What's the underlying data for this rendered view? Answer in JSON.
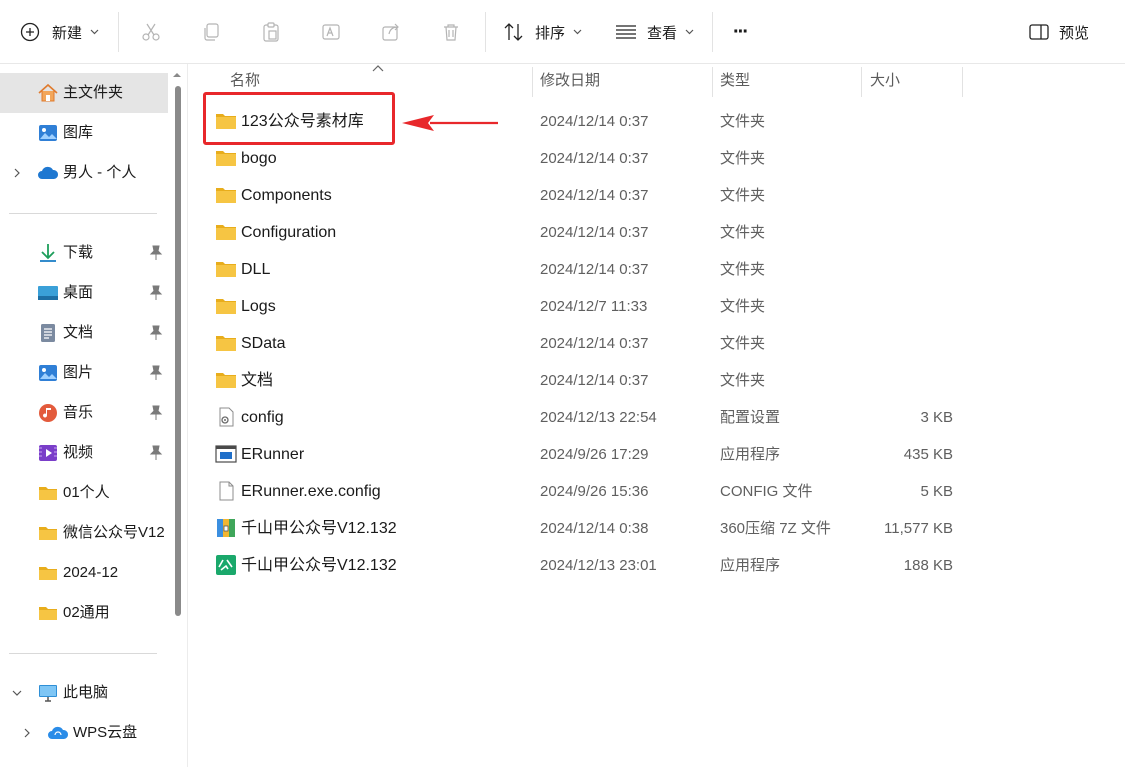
{
  "toolbar": {
    "new_label": "新建",
    "sort_label": "排序",
    "view_label": "查看",
    "more_label": "···",
    "preview_label": "预览"
  },
  "sidebar": {
    "items": [
      {
        "label": "主文件夹",
        "icon": "home-icon",
        "selected": true
      },
      {
        "label": "图库",
        "icon": "gallery-icon"
      },
      {
        "label": "男人 - 个人",
        "icon": "onedrive-cloud-icon",
        "expandable": true
      },
      {
        "label": "下载",
        "icon": "download-icon",
        "pinned": true
      },
      {
        "label": "桌面",
        "icon": "desktop-icon",
        "pinned": true
      },
      {
        "label": "文档",
        "icon": "document-icon",
        "pinned": true
      },
      {
        "label": "图片",
        "icon": "pictures-icon",
        "pinned": true
      },
      {
        "label": "音乐",
        "icon": "music-icon",
        "pinned": true
      },
      {
        "label": "视频",
        "icon": "video-icon",
        "pinned": true
      },
      {
        "label": "01个人",
        "icon": "folder-icon"
      },
      {
        "label": "微信公众号V12",
        "icon": "folder-icon"
      },
      {
        "label": "2024-12",
        "icon": "folder-icon"
      },
      {
        "label": "02通用",
        "icon": "folder-icon"
      },
      {
        "label": "此电脑",
        "icon": "this-pc-icon",
        "expanded": true
      },
      {
        "label": "WPS云盘",
        "icon": "wps-cloud-icon",
        "expandable": true
      }
    ]
  },
  "columns": {
    "name": "名称",
    "date": "修改日期",
    "type": "类型",
    "size": "大小"
  },
  "files": [
    {
      "name": "123公众号素材库",
      "date": "2024/12/14 0:37",
      "type": "文件夹",
      "size": "",
      "icon": "folder-icon"
    },
    {
      "name": "bogo",
      "date": "2024/12/14 0:37",
      "type": "文件夹",
      "size": "",
      "icon": "folder-icon"
    },
    {
      "name": "Components",
      "date": "2024/12/14 0:37",
      "type": "文件夹",
      "size": "",
      "icon": "folder-icon"
    },
    {
      "name": "Configuration",
      "date": "2024/12/14 0:37",
      "type": "文件夹",
      "size": "",
      "icon": "folder-icon"
    },
    {
      "name": "DLL",
      "date": "2024/12/14 0:37",
      "type": "文件夹",
      "size": "",
      "icon": "folder-icon"
    },
    {
      "name": "Logs",
      "date": "2024/12/7 11:33",
      "type": "文件夹",
      "size": "",
      "icon": "folder-icon"
    },
    {
      "name": "SData",
      "date": "2024/12/14 0:37",
      "type": "文件夹",
      "size": "",
      "icon": "folder-icon"
    },
    {
      "name": "文档",
      "date": "2024/12/14 0:37",
      "type": "文件夹",
      "size": "",
      "icon": "folder-icon"
    },
    {
      "name": "config",
      "date": "2024/12/13 22:54",
      "type": "配置设置",
      "size": "3 KB",
      "icon": "config-file-icon"
    },
    {
      "name": "ERunner",
      "date": "2024/9/26 17:29",
      "type": "应用程序",
      "size": "435 KB",
      "icon": "app-window-icon"
    },
    {
      "name": "ERunner.exe.config",
      "date": "2024/9/26 15:36",
      "type": "CONFIG 文件",
      "size": "5 KB",
      "icon": "blank-file-icon"
    },
    {
      "name": "千山甲公众号V12.132",
      "date": "2024/12/14 0:38",
      "type": "360压缩 7Z 文件",
      "size": "11,577 KB",
      "icon": "archive-icon"
    },
    {
      "name": "千山甲公众号V12.132",
      "date": "2024/12/13 23:01",
      "type": "应用程序",
      "size": "188 KB",
      "icon": "gongzhonghao-app-icon"
    }
  ],
  "colors": {
    "highlight": "#e8282b",
    "folder": "#f6c543",
    "selected_bg": "#e5e5e5"
  }
}
